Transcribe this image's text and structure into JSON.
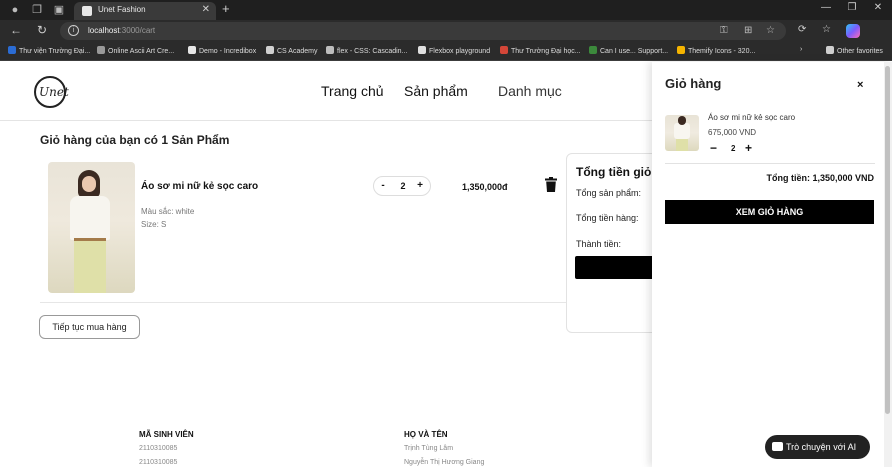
{
  "browser": {
    "tab_title": "Unet Fashion",
    "url_host": "localhost",
    "url_path": ":3000/cart",
    "bookmarks": [
      "Thư viện Trường Đại...",
      "Online Ascii Art Cre...",
      "Demo - Incredibox",
      "CS Academy",
      "flex - CSS: Cascadin...",
      "Flexbox playground",
      "Thư Trường Đại học...",
      "Can I use... Support...",
      "Themify Icons - 320..."
    ],
    "other_favorites": "Other favorites"
  },
  "header": {
    "logo_text": "Unet",
    "nav": [
      "Trang chủ",
      "Sản phẩm",
      "Danh mục"
    ]
  },
  "cart": {
    "title": "Giỏ hàng của bạn có 1 Sản Phẩm",
    "item": {
      "name": "Áo sơ mi nữ kẻ sọc caro",
      "color": "Màu sắc: white",
      "size": "Size: S",
      "qty": "2",
      "minus": "-",
      "plus": "+",
      "total": "1,350,000đ"
    },
    "continue_label": "Tiếp tục mua hàng"
  },
  "summary": {
    "title": "Tổng tiền giỏ hàng",
    "labels": [
      "Tổng sản phẩm:",
      "Tổng tiền hàng:",
      "Thành tiền:"
    ]
  },
  "footer": {
    "id_header": "MÃ SINH VIÊN",
    "ids": [
      "2110310085",
      "2110310085"
    ],
    "name_header": "HỌ VÀ TÊN",
    "names": [
      "Trịnh Tùng Lâm",
      "Nguyễn Thị Hương Giang"
    ]
  },
  "drawer": {
    "title": "Giỏ hàng",
    "close": "×",
    "item_name": "Áo sơ mi nữ kẻ sọc caro",
    "item_price": "675,000 VND",
    "qty": "2",
    "minus": "−",
    "plus": "+",
    "total": "Tổng tiền: 1,350,000 VND",
    "button": "XEM GIỎ HÀNG"
  },
  "chat": {
    "label": "Trò chuyện với AI"
  },
  "colors": {
    "accent": "#000000",
    "chrome_bg": "#1f1f1f"
  }
}
